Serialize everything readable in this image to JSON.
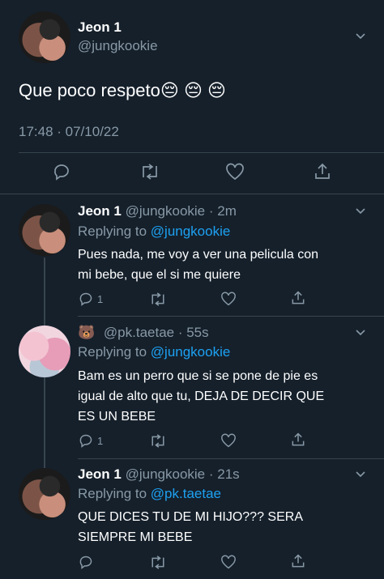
{
  "main_tweet": {
    "name": "Jeon 1",
    "handle": "@jungkookie",
    "text": "Que poco respeto😔 😔 😔",
    "time": "17:48 · 07/10/22"
  },
  "replies": [
    {
      "name": "Jeon 1",
      "handle_time": "@jungkookie · 2m",
      "replying_prefix": "Replying to ",
      "replying_to": "@jungkookie",
      "text_line1": "Pues nada, me voy a ver una pelicula con",
      "text_line2": "mi bebe, que el si me quiere",
      "reply_count": "1"
    },
    {
      "name_emoji": "🐻",
      "handle_time": "@pk.taetae · 55s",
      "replying_prefix": "Replying to ",
      "replying_to": "@jungkookie",
      "text_line1": "Bam es un perro que si se pone de pie es",
      "text_line2": "igual de alto que tu, DEJA DE DECIR QUE",
      "text_line3": "ES UN BEBE",
      "reply_count": "1"
    },
    {
      "name": "Jeon 1",
      "handle_time": "@jungkookie · 21s",
      "replying_prefix": "Replying to ",
      "replying_to": "@pk.taetae",
      "text_line1": "QUE DICES TU DE MI HIJO??? SERA",
      "text_line2": "SIEMPRE MI BEBE",
      "reply_count": ""
    }
  ],
  "colors": {
    "background": "#15202b",
    "muted": "#8899a6",
    "link": "#1da1f2",
    "divider": "#38444d"
  }
}
